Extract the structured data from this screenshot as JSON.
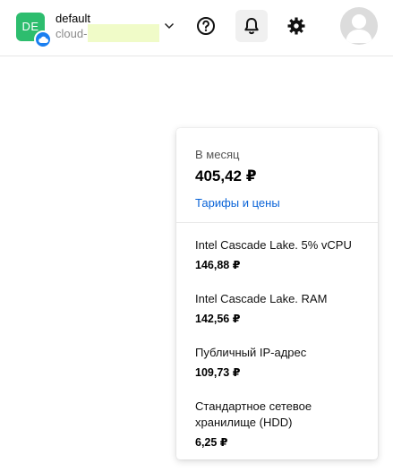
{
  "header": {
    "project_initials": "DE",
    "project_name": "default",
    "cloud_prefix": "cloud-",
    "icons": {
      "project_dropdown": "chevron-down-icon",
      "cloud_badge": "cloud-icon",
      "help": "help-circle-icon",
      "notifications": "bell-icon",
      "settings": "gear-icon",
      "user": "user-avatar-icon"
    },
    "colors": {
      "project_avatar": "#2dbd6e",
      "cloud_badge": "#1a7ff0"
    }
  },
  "pricing": {
    "period_label": "В месяц",
    "total": "405,42 ₽",
    "tariffs_link": "Тарифы и цены",
    "items": [
      {
        "name": "Intel Cascade Lake. 5% vCPU",
        "price": "146,88 ₽"
      },
      {
        "name": "Intel Cascade Lake. RAM",
        "price": "142,56 ₽"
      },
      {
        "name": "Публичный IP-адрес",
        "price": "109,73 ₽"
      },
      {
        "name": "Стандартное сетевое хранилище (HDD)",
        "price": "6,25 ₽"
      }
    ],
    "colors": {
      "link": "#0a64d8"
    }
  }
}
